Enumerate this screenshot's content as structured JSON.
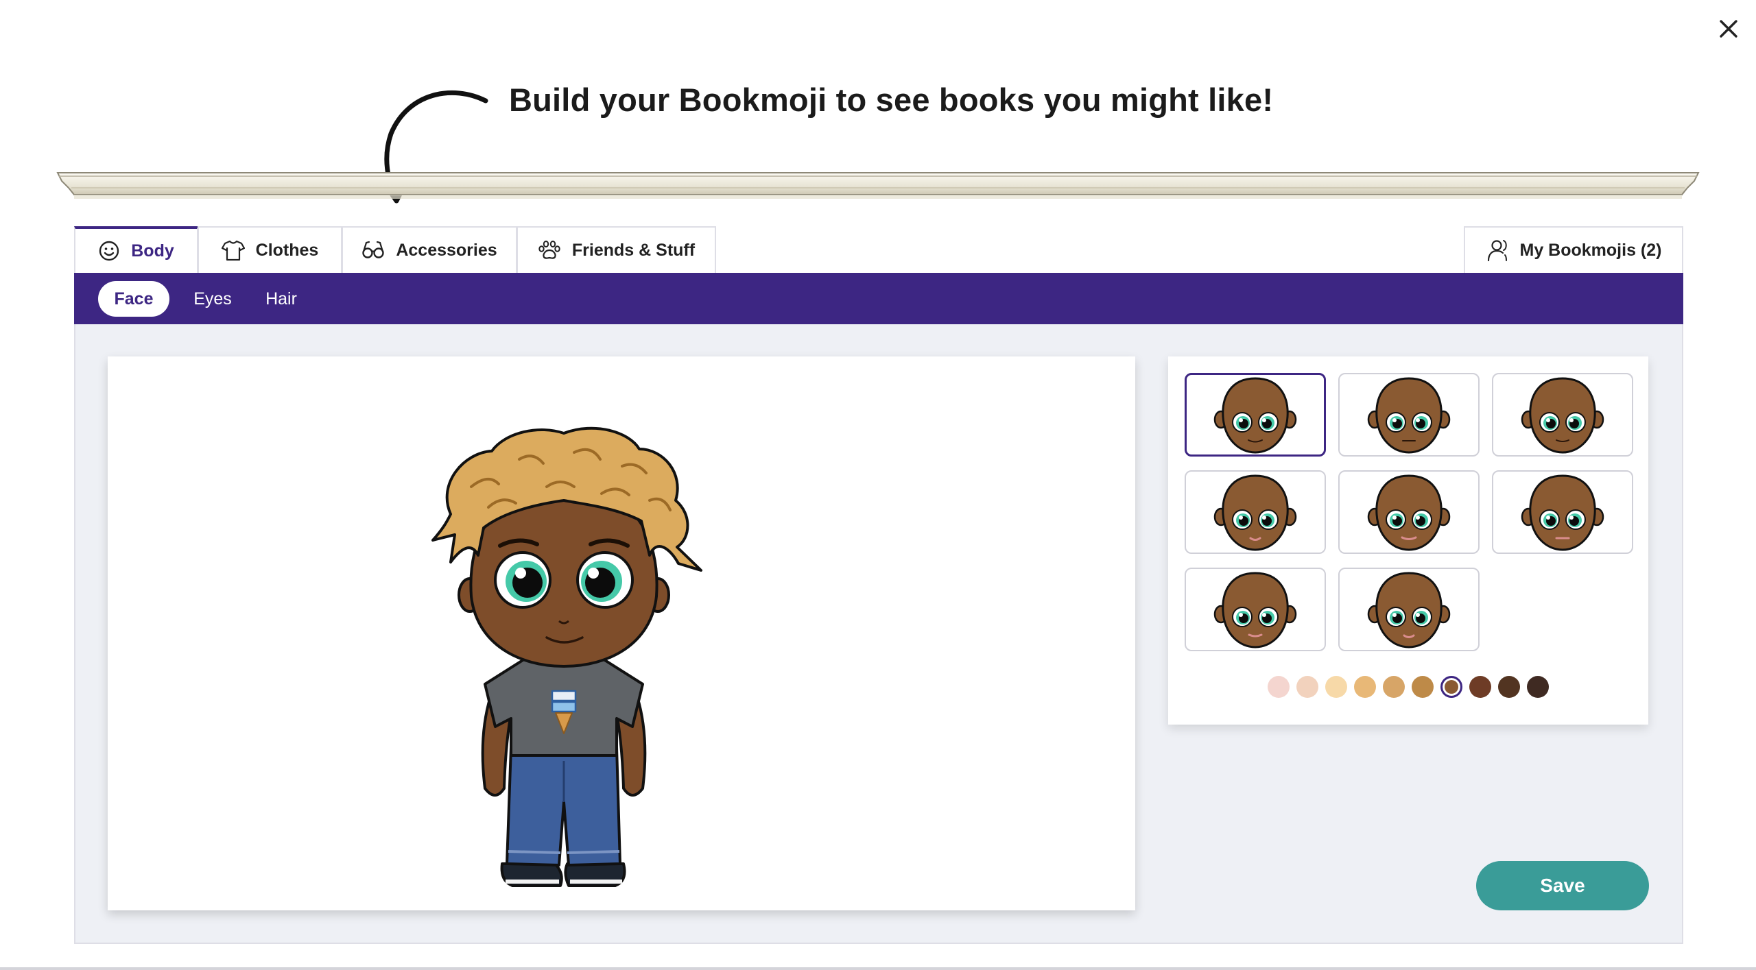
{
  "headline": "Build your Bookmoji to see books you might like!",
  "tabs": [
    {
      "label": "Body",
      "icon": "smiley-icon",
      "active": true
    },
    {
      "label": "Clothes",
      "icon": "shirt-icon",
      "active": false
    },
    {
      "label": "Accessories",
      "icon": "glasses-icon",
      "active": false
    },
    {
      "label": "Friends & Stuff",
      "icon": "paw-icon",
      "active": false
    }
  ],
  "my_bookmojis": {
    "label": "My Bookmojis (2)",
    "icon": "user-icon"
  },
  "subtabs": [
    {
      "label": "Face",
      "active": true
    },
    {
      "label": "Eyes",
      "active": false
    },
    {
      "label": "Hair",
      "active": false
    }
  ],
  "face_options": {
    "count": 8,
    "selected_index": 0,
    "skin_color": "#8a5a32"
  },
  "skin_swatches": {
    "colors": [
      "#f4d5cf",
      "#f2d2bd",
      "#f7d9a8",
      "#e8b877",
      "#d7a567",
      "#be8a48",
      "#8a5a32",
      "#6e3c26",
      "#523421",
      "#3f2a22"
    ],
    "selected_index": 6
  },
  "save_label": "Save",
  "colors": {
    "brand_purple": "#3d2683",
    "save_teal": "#3a9c98",
    "workspace_bg": "#eef0f5"
  }
}
